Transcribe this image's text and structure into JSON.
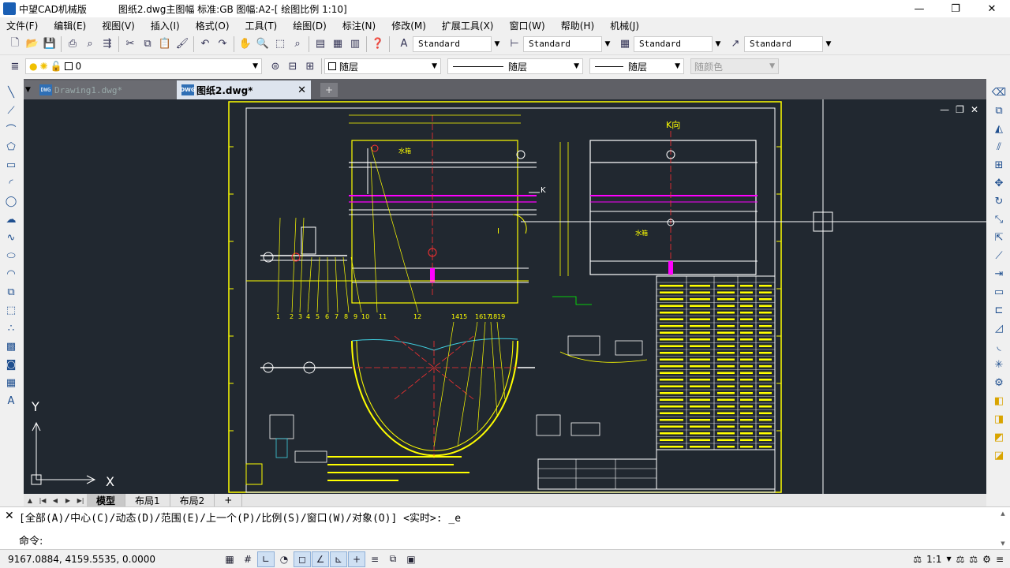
{
  "titlebar": {
    "app_name": "中望CAD机械版",
    "doc_title": "图纸2.dwg主图幅  标准:GB 图幅:A2-[ 绘图比例 1:10]",
    "minimize": "—",
    "restore": "❐",
    "close": "✕"
  },
  "menu": [
    "文件(F)",
    "编辑(E)",
    "视图(V)",
    "插入(I)",
    "格式(O)",
    "工具(T)",
    "绘图(D)",
    "标注(N)",
    "修改(M)",
    "扩展工具(X)",
    "窗口(W)",
    "帮助(H)",
    "机械(J)"
  ],
  "styles": {
    "text_style": "Standard",
    "dim_style": "Standard",
    "table_style": "Standard",
    "multileader_style": "Standard"
  },
  "layer": {
    "current": "0"
  },
  "properties": {
    "color": "随层",
    "linetype": "随层",
    "lineweight": "随层",
    "plotstyle": "随颜色"
  },
  "doctabs": {
    "tab1": "Drawing1.dwg*",
    "tab2": "图纸2.dwg*",
    "badge": "DWG",
    "add": "+",
    "close": "✕"
  },
  "layout_tabs": [
    "模型",
    "布局1",
    "布局2",
    "+"
  ],
  "ucs": {
    "x": "X",
    "y": "Y"
  },
  "command": {
    "history": "[全部(A)/中心(C)/动态(D)/范围(E)/上一个(P)/比例(S)/窗口(W)/对象(O)] <实时>: _e",
    "prompt": "命令:"
  },
  "status": {
    "coords": "9167.0884, 4159.5535, 0.0000",
    "scale": "1:1"
  },
  "drawing": {
    "section_label": "K向",
    "tank_label_1": "水箱",
    "tank_label_2": "水箱",
    "view_k": "K",
    "view_i": "I",
    "balloons_a": [
      "1",
      "2",
      "3",
      "4",
      "5",
      "6",
      "7",
      "8",
      "9",
      "10",
      "11",
      "12"
    ],
    "balloons_b": [
      "14",
      "15",
      "16",
      "17",
      "18",
      "19"
    ]
  },
  "colors": {
    "canvas": "#212830",
    "yellow": "#ffff00",
    "white": "#ffffff",
    "magenta": "#ff00ff",
    "cyan": "#40d0e0",
    "green": "#00ff00",
    "red": "#ff3030"
  }
}
